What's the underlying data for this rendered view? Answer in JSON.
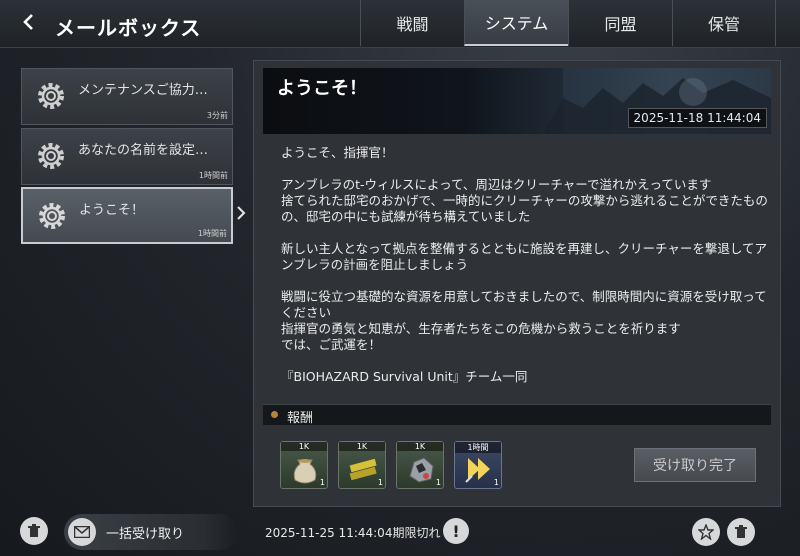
{
  "header": {
    "back_icon": "chevron-left-icon",
    "title": "メールボックス",
    "tabs": [
      {
        "label": "戦闘",
        "active": false
      },
      {
        "label": "システム",
        "active": true
      },
      {
        "label": "同盟",
        "active": false
      },
      {
        "label": "保管",
        "active": false
      }
    ]
  },
  "mail_list": [
    {
      "subject": "メンテナンスご協力…",
      "time": "3分前",
      "icon": "gear-icon",
      "selected": false
    },
    {
      "subject": "あなたの名前を設定…",
      "time": "1時間前",
      "icon": "gear-icon",
      "selected": false
    },
    {
      "subject": "ようこそ！",
      "time": "1時間前",
      "icon": "gear-icon",
      "selected": true
    }
  ],
  "detail": {
    "title": "ようこそ！",
    "date": "2025-11-18 11:44:04",
    "paragraphs": [
      "ようこそ、指揮官！",
      "アンブレラのt-ウィルスによって、周辺はクリーチャーで溢れかえっています\n捨てられた邸宅のおかげで、一時的にクリーチャーの攻撃から逃れることができたものの、邸宅の中にも試練が待ち構えていました",
      "新しい主人となって拠点を整備するとともに施設を再建し、クリーチャーを撃退してアンブレラの計画を阻止しましょう",
      "戦闘に役立つ基礎的な資源を用意しておきましたので、制限時間内に資源を受け取ってください\n指揮官の勇気と知恵が、生存者たちをこの危機から救うことを祈ります\nでは、ご武運を！",
      "『BIOHAZARD Survival Unit』チーム一同"
    ],
    "reward_label": "報酬",
    "rewards": [
      {
        "top": "1K",
        "count": "1",
        "icon": "food-sack-icon",
        "color": "green"
      },
      {
        "top": "1K",
        "count": "1",
        "icon": "lumber-icon",
        "color": "green"
      },
      {
        "top": "1K",
        "count": "1",
        "icon": "ore-icon",
        "color": "green"
      },
      {
        "top": "1時間",
        "count": "1",
        "icon": "speedup-icon",
        "color": "blue"
      }
    ],
    "claim_button": "受け取り完了"
  },
  "footer": {
    "delete_read_icon": "trash-icon",
    "bulk_claim_label": "一括受け取り",
    "bulk_claim_icon": "envelope-icon",
    "expiry": "2025-11-25 11:44:04期限切れ",
    "warn_icon": "exclamation-icon",
    "star_icon": "star-icon",
    "delete_icon": "trash-icon"
  }
}
